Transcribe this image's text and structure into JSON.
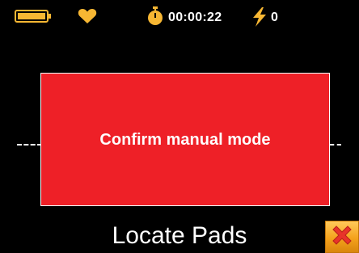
{
  "status": {
    "battery_icon": "battery-full-icon",
    "heart_icon": "heart-icon",
    "stopwatch_icon": "stopwatch-icon",
    "timer": "00:00:22",
    "bolt_icon": "lightning-bolt-icon",
    "shock_count": "0"
  },
  "dialog": {
    "confirm_label": "Confirm manual mode"
  },
  "prompt": "Locate Pads",
  "cancel": {
    "icon": "close-x-icon"
  },
  "colors": {
    "background": "#000000",
    "accent_yellow": "#f7b733",
    "confirm_red": "#ee2027",
    "text": "#ffffff",
    "cancel_x": "#e8332a"
  }
}
